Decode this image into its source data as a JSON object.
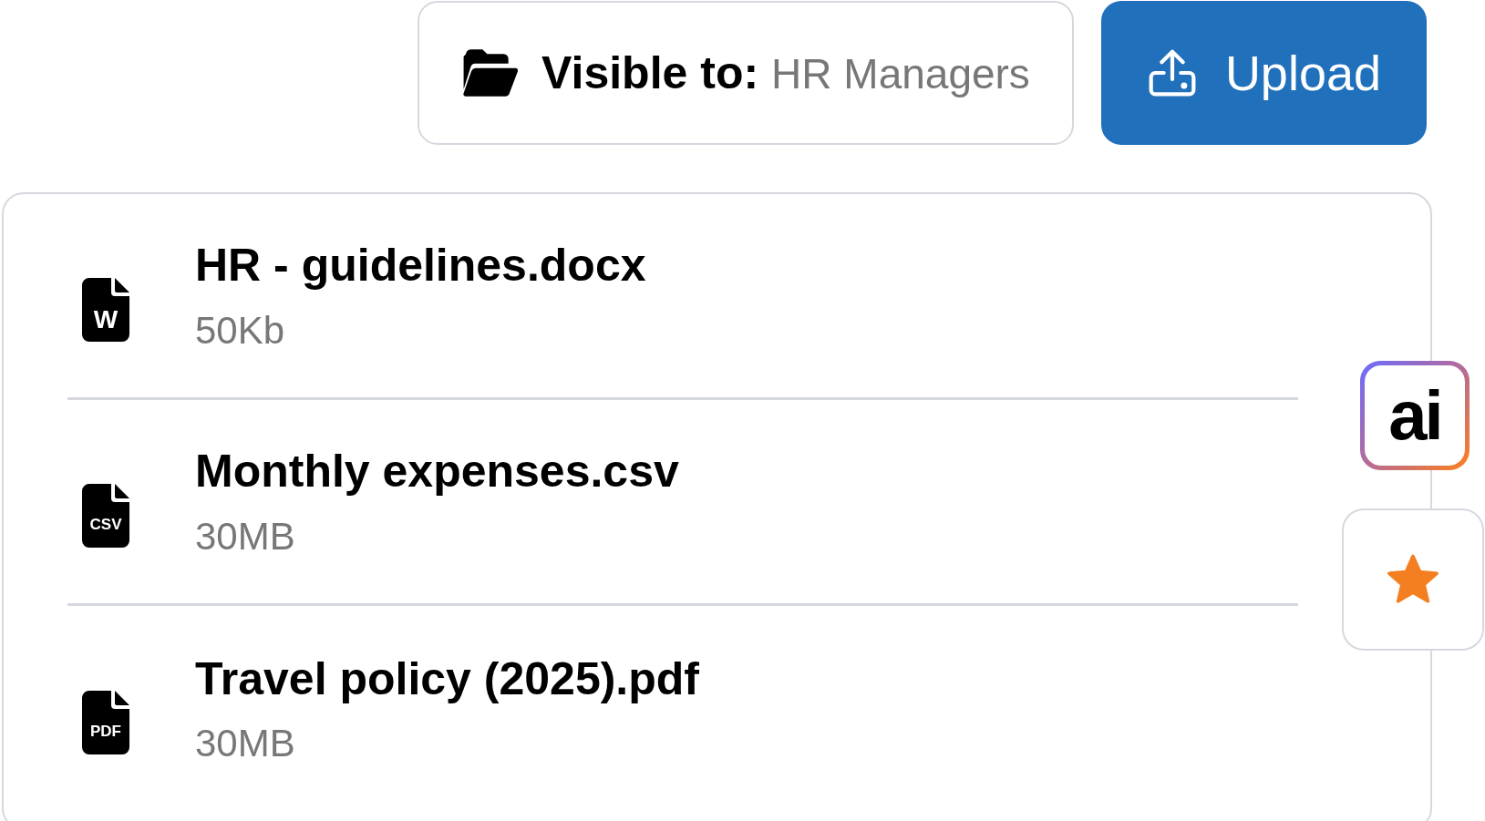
{
  "visibility": {
    "label": "Visible to:",
    "value": "HR Managers"
  },
  "upload_button": {
    "label": "Upload"
  },
  "files": [
    {
      "name": "HR - guidelines.docx",
      "size": "50Kb",
      "type_label": "W"
    },
    {
      "name": "Monthly expenses.csv",
      "size": "30MB",
      "type_label": "CSV"
    },
    {
      "name": "Travel policy (2025).pdf",
      "size": "30MB",
      "type_label": "PDF"
    }
  ],
  "side_actions": [
    {
      "kind": "ai",
      "label": "ai"
    },
    {
      "kind": "star"
    }
  ]
}
